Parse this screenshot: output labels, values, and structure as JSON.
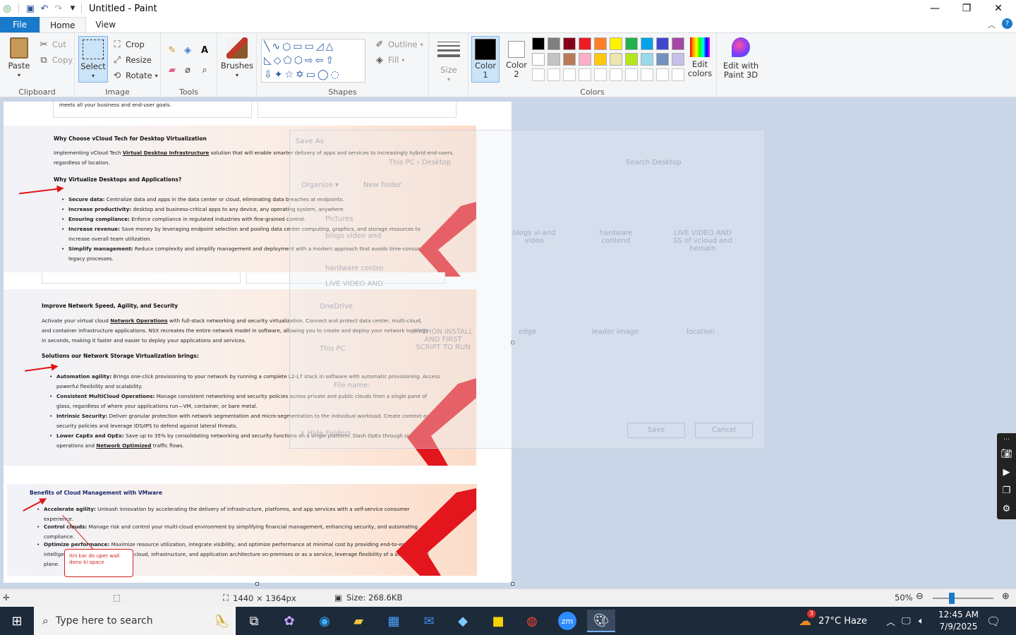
{
  "window": {
    "title": "Untitled - Paint",
    "minimize": "—",
    "maximize": "❐",
    "close": "✕"
  },
  "menu": {
    "tabs": [
      {
        "label": "File"
      },
      {
        "label": "Home"
      },
      {
        "label": "View"
      }
    ]
  },
  "ribbon": {
    "clipboard": {
      "paste": "Paste",
      "cut": "Cut",
      "copy": "Copy",
      "label": "Clipboard"
    },
    "image": {
      "select": "Select",
      "crop": "Crop",
      "resize": "Resize",
      "rotate": "Rotate",
      "label": "Image"
    },
    "tools": {
      "label": "Tools"
    },
    "brushes": {
      "label": "Brushes"
    },
    "shapes": {
      "outline": "Outline",
      "fill": "Fill",
      "label": "Shapes"
    },
    "size": {
      "label": "Size"
    },
    "colors": {
      "color1": "Color 1",
      "color2": "Color 2",
      "edit_colors": "Edit colors",
      "label": "Colors",
      "palette": [
        "#000000",
        "#7f7f7f",
        "#880015",
        "#ed1c24",
        "#ff7f27",
        "#fff200",
        "#22b14c",
        "#00a2e8",
        "#3f48cc",
        "#a349a4",
        "#ffffff",
        "#c3c3c3",
        "#b97a57",
        "#ffaec9",
        "#ffc90e",
        "#efe4b0",
        "#b5e61d",
        "#99d9ea",
        "#7092be",
        "#c8bfe7"
      ]
    },
    "paint3d": "Edit with Paint 3D"
  },
  "document": {
    "top_fragment": "meets all your business and end-user goals.",
    "s1": {
      "heading": "Why Choose vCloud Tech for Desktop Virtualization",
      "para_a": "Implementing vCloud Tech ",
      "para_link": "Virtual Desktop Infrastructure",
      "para_b": " solution that will enable smarter delivery of apps and services to increasingly hybrid end-users, regardless of location.",
      "subheading": "Why Virtualize Desktops and Applications?",
      "bullets": [
        {
          "b": "Secure data:",
          "t": " Centralize data and apps in the data center or cloud, eliminating data breaches at endpoints."
        },
        {
          "b": "Increase productivity:",
          "t": " desktop and business-critical apps to any device, any operating system, anywhere."
        },
        {
          "b": "Ensuring compliance:",
          "t": " Enforce compliance in regulated industries with fine-grained control."
        },
        {
          "b": "Increase revenue:",
          "t": " Save money by leveraging endpoint selection and pooling data center computing, graphics, and storage resources to increase overall team utilization."
        },
        {
          "b": "Simplify management:",
          "t": " Reduce complexity and simplify management and deployment with a modern approach that avoids time-consuming legacy processes."
        }
      ]
    },
    "s2": {
      "heading": "Improve Network Speed, Agility, and Security",
      "para_a": "Activate your virtual cloud ",
      "para_link": "Network Operations",
      "para_b": " with full-stack networking and security virtualization. Connect and protect data center, multi-cloud, and container infrastructure applications. NSX recreates the entire network model in software, allowing you to create and deploy your network topology in seconds, making it faster and easier to deploy your applications and services.",
      "subheading": "Solutions our Network Storage Virtualization brings:",
      "bullets": [
        {
          "b": "Automation agility:",
          "t": " Brings one-click provisioning to your network by running a complete L2-L7 stack in software with automatic provisioning. Access powerful flexibility and scalability."
        },
        {
          "b": "Consistent MultiCloud Operations:",
          "t": " Manage consistent networking and security policies across private and public clouds from a single pane of glass, regardless of where your applications run—VM, container, or bare metal."
        },
        {
          "b": "Intrinsic Security:",
          "t": " Deliver granular protection with network segmentation and micro-segmentation to the individual workload. Create context-aware security policies and leverage IDS/IPS to defend against lateral threats."
        },
        {
          "b": "Lower CapEx and OpEx:",
          "t": " Save up to 35% by consolidating networking and security functions on a single platform. Slash OpEx through simplified operations and ",
          "link": "Network Optimized",
          "t2": " traffic flows."
        }
      ]
    },
    "s3": {
      "heading": "Benefits of Cloud Management with VMware",
      "bullets": [
        {
          "b": "Accelerate agility:",
          "t": " Unleash innovation by accelerating the delivery of infrastructure, platforms, and app services with a self-service consumer experience."
        },
        {
          "b": "Control clouds:",
          "t": " Manage risk and control your multi-cloud environment by simplifying financial management, enhancing security, and automating compliance."
        },
        {
          "b": "Optimize performance:",
          "t": " Maximize resource utilization, integrate visibility, and optimize performance at minimal cost by providing end-to-end intelligence of choice Manage your cloud, infrastructure, and application architecture on-premises or as a service, leverage flexibility of a single control plane."
        }
      ]
    },
    "callout": "itni kar do uper wali dono ki space"
  },
  "ghost_dialog": {
    "title": "Save As",
    "path": "This PC  ›  Desktop",
    "search": "Search Desktop",
    "organize": "Organize ▾",
    "new_folder": "New folder",
    "nav": [
      "Pictures",
      "blogs video and",
      "hardware contro",
      "LIVE VIDEO AND",
      "OneDrive",
      "This PC"
    ],
    "tiles": [
      "blogs vi and video",
      "hardware contend",
      "LIVE VIDEO AND SS of vcloud and hemain",
      "edge",
      "leader image",
      "location",
      "PYTHON INSTALL AND FIRST SCRIPT TO RUN"
    ],
    "file_name_label": "File name:",
    "hide_folders": "∧  Hide Folders",
    "save": "Save",
    "cancel": "Cancel"
  },
  "status": {
    "dimensions": "1440 × 1364px",
    "size": "Size: 268.6KB",
    "zoom": "50%",
    "zoom_fraction": 0.5
  },
  "taskbar": {
    "search_placeholder": "Type here to search",
    "weather": "27°C  Haze",
    "weather_badge": "3",
    "time": "12:45 AM",
    "date": "7/9/2025"
  }
}
